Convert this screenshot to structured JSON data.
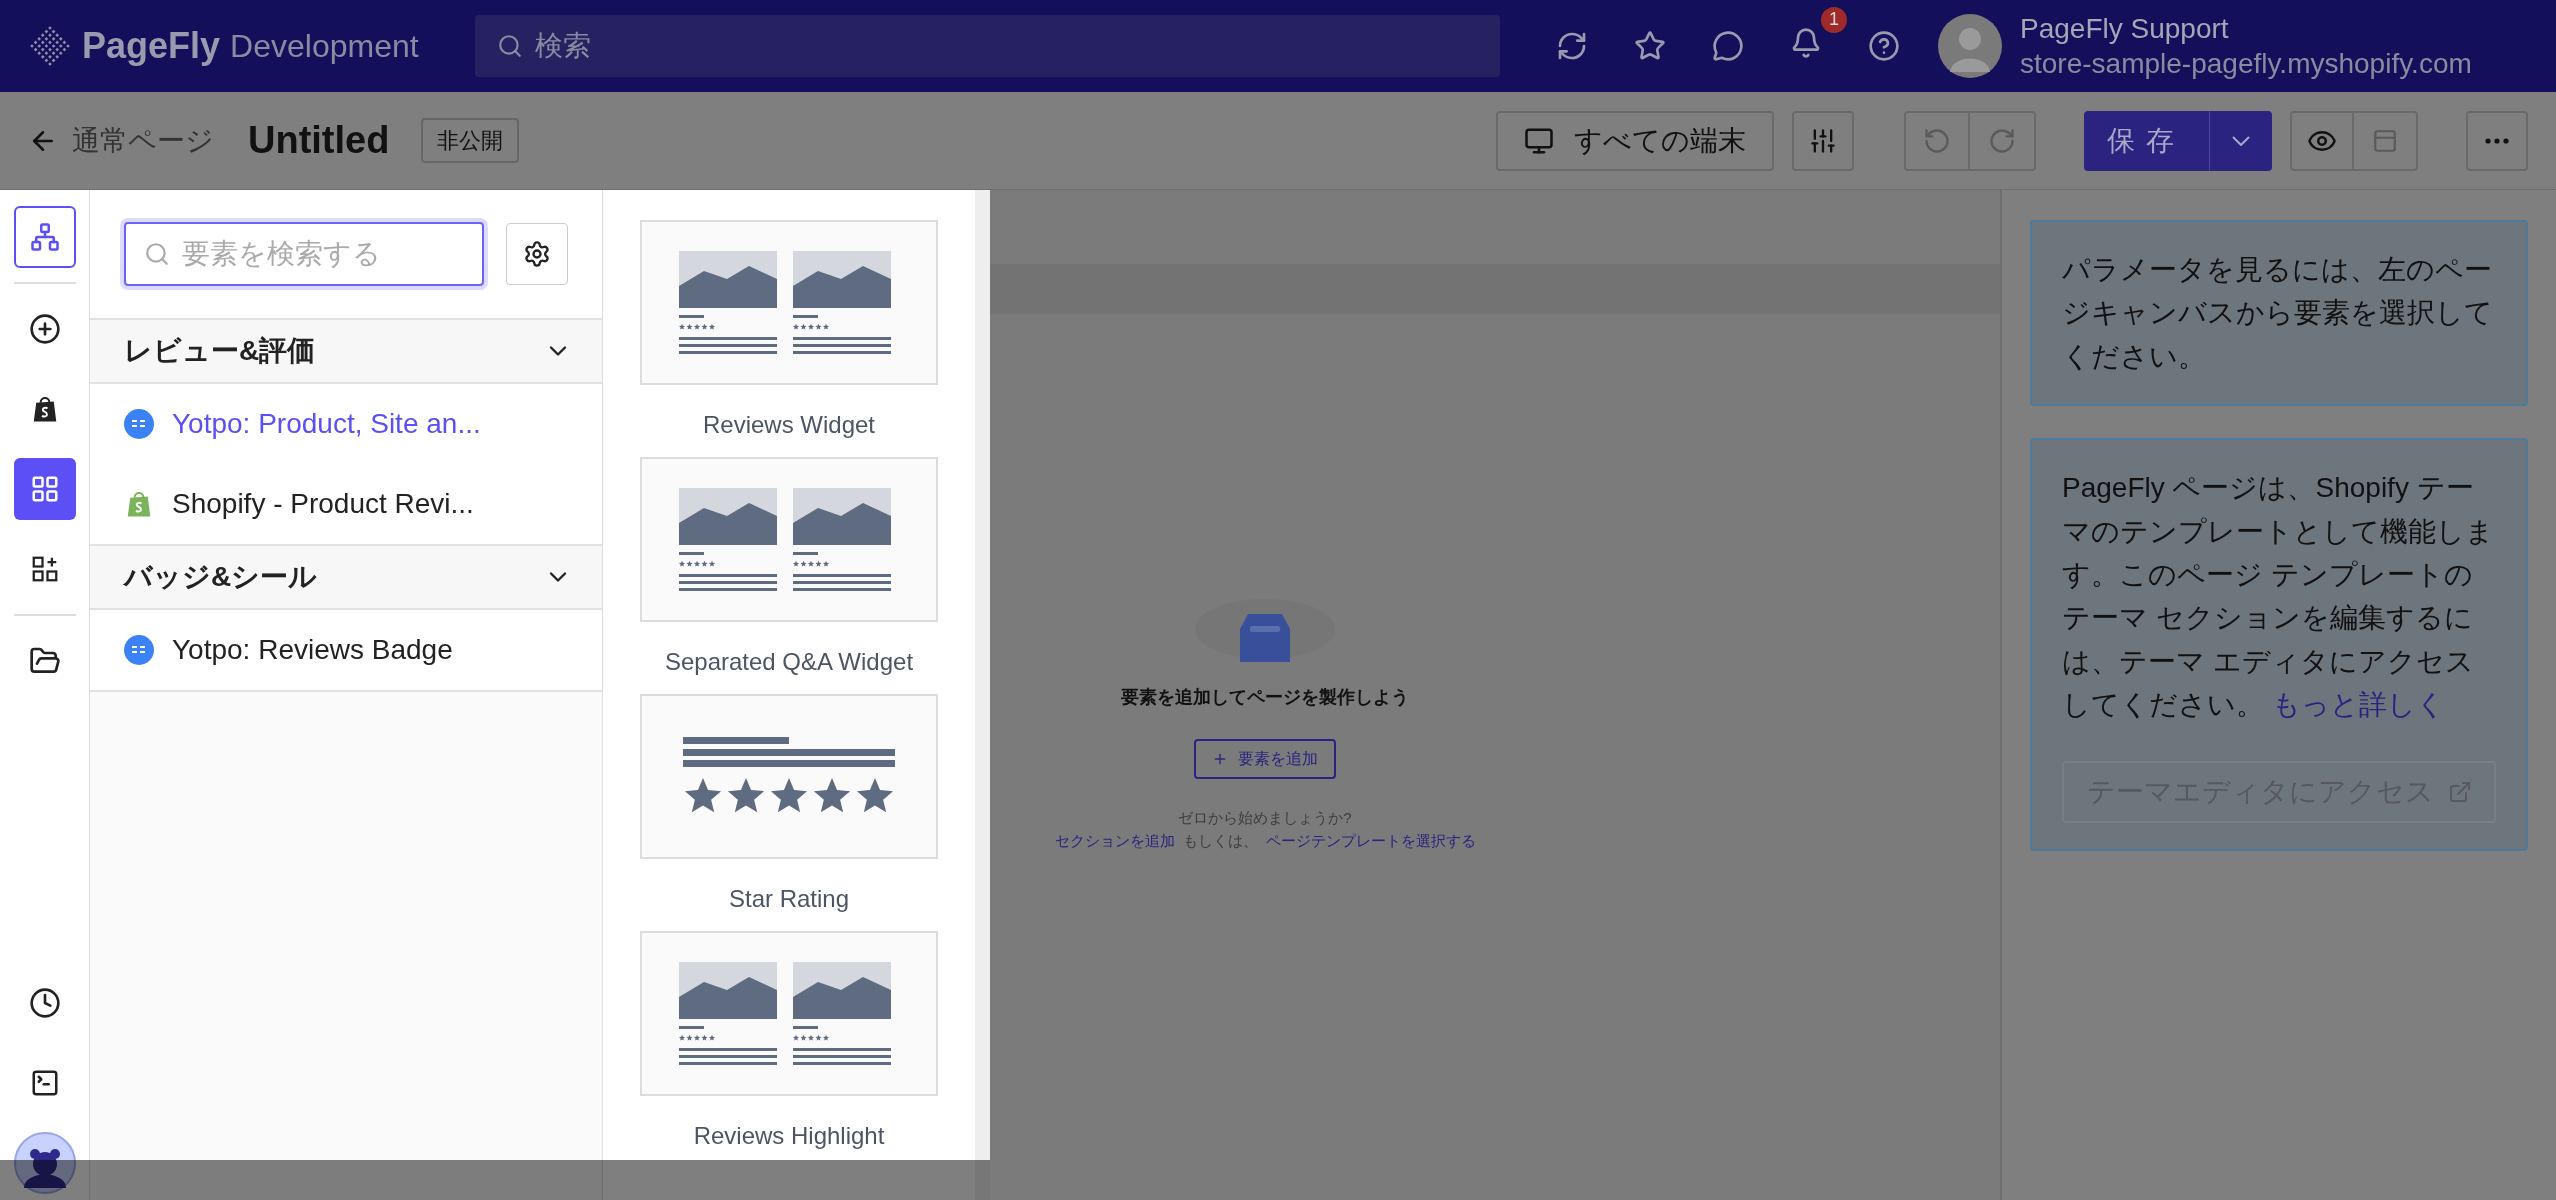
{
  "topbar": {
    "brand": "PageFly",
    "brand_suffix": "Development",
    "search": {
      "placeholder": "検索"
    },
    "notifications": "1",
    "user": {
      "name": "PageFly Support",
      "store": "store-sample-pagefly.myshopify.com"
    }
  },
  "toolbar": {
    "back": "通常ページ",
    "title": "Untitled",
    "status": "非公開",
    "device": "すべての端末",
    "save": "保存"
  },
  "rail_groups": [
    [
      {
        "kind": "sitemap",
        "selected": false,
        "focused": true
      }
    ],
    [
      {
        "kind": "add",
        "selected": false,
        "focused": false
      },
      {
        "kind": "shopify",
        "selected": false,
        "focused": false
      },
      {
        "kind": "grid",
        "selected": true,
        "focused": false
      },
      {
        "kind": "grid-plus",
        "selected": false,
        "focused": false
      }
    ],
    [
      {
        "kind": "folder",
        "selected": false,
        "focused": false
      }
    ]
  ],
  "rail_bottom": [
    {
      "kind": "history",
      "selected": false,
      "focused": false
    },
    {
      "kind": "terminal",
      "selected": false,
      "focused": false
    }
  ],
  "element_search": {
    "placeholder": "要素を検索する"
  },
  "sections": [
    {
      "title": "レビュー&評価",
      "expanded": true,
      "items": [
        {
          "label": "Yotpo: Product, Site an...",
          "kind": "yotpo",
          "selected": true
        },
        {
          "label": "Shopify - Product Revi...",
          "kind": "shopify",
          "selected": false
        }
      ]
    },
    {
      "title": "バッジ&シール",
      "expanded": true,
      "items": [
        {
          "label": "Yotpo: Reviews Badge",
          "kind": "yotpo",
          "selected": false
        }
      ]
    }
  ],
  "widgets": [
    {
      "label": "Reviews Widget",
      "kind": "gallery"
    },
    {
      "label": "Separated Q&A Widget",
      "kind": "gallery"
    },
    {
      "label": "Star Rating",
      "kind": "rating"
    },
    {
      "label": "Reviews Highlight",
      "kind": "gallery"
    }
  ],
  "canvas": {
    "heading": "要素を追加してページを製作しよう",
    "add_button": "要素を追加",
    "prompt": "ゼロから始めましょうか?",
    "link_section": "セクションを追加",
    "or": "もしくは、",
    "link_template": "ページテンプレートを選択する"
  },
  "inspector": {
    "hint": "パラメータを見るには、左のページキャンバスから要素を選択してください。",
    "info": "PageFly ページは、Shopify テーマのテンプレートとして機能します。このページ テンプレートのテーマ セクションを編集するには、テーマ エディタにアクセスしてください。",
    "learn_more": "もっと詳しく",
    "editor_button": {
      "label": "テーマエディタにアクセス",
      "disabled": true
    }
  }
}
